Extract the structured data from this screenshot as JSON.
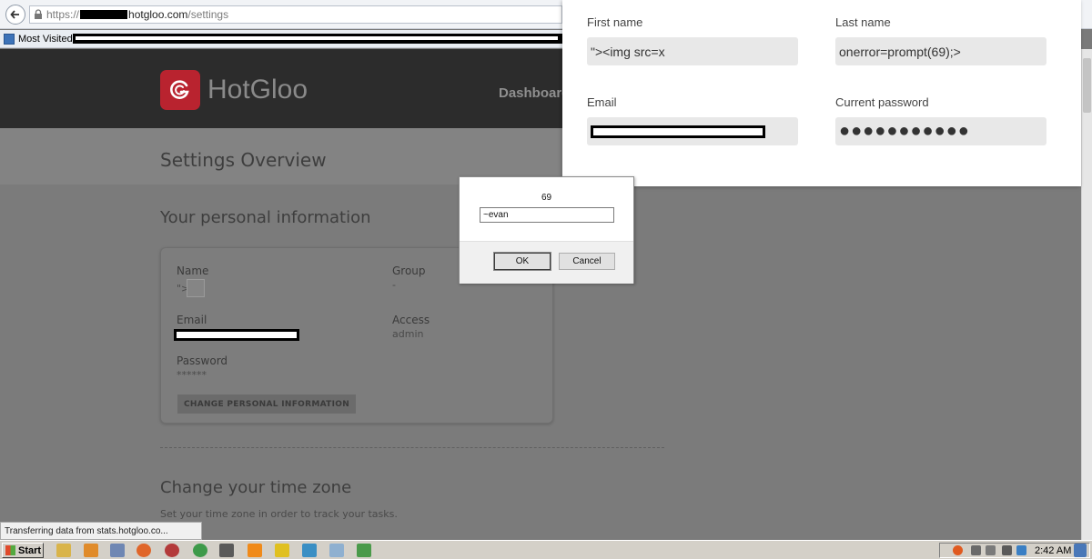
{
  "browser": {
    "url_scheme": "https://",
    "url_host": "hotgloo.com",
    "url_path": "/settings",
    "bookmark_label": "Most Visited",
    "status_text": "Transferring data from stats.hotgloo.co..."
  },
  "header": {
    "logo_text": "HotGloo",
    "nav_dashboard": "Dashboard"
  },
  "settings": {
    "title": "Settings Overview",
    "section_title": "Your personal information",
    "name_label": "Name",
    "name_value": "\">",
    "group_label": "Group",
    "group_value": "-",
    "email_label": "Email",
    "access_label": "Access",
    "access_value": "admin",
    "password_label": "Password",
    "password_value": "******",
    "change_button": "CHANGE PERSONAL INFORMATION",
    "tz_title": "Change your time zone",
    "tz_subtitle": "Set your time zone in order to track your tasks."
  },
  "form": {
    "first_name_label": "First name",
    "first_name_value": "\"><img src=x",
    "last_name_label": "Last name",
    "last_name_value": "onerror=prompt(69);>",
    "email_label": "Email",
    "current_password_label": "Current password",
    "current_password_value": "●●●●●●●●●●●"
  },
  "prompt": {
    "message": "69",
    "input_value": "~evan",
    "ok_label": "OK",
    "cancel_label": "Cancel"
  },
  "taskbar": {
    "start_label": "Start",
    "clock": "2:42 AM"
  }
}
